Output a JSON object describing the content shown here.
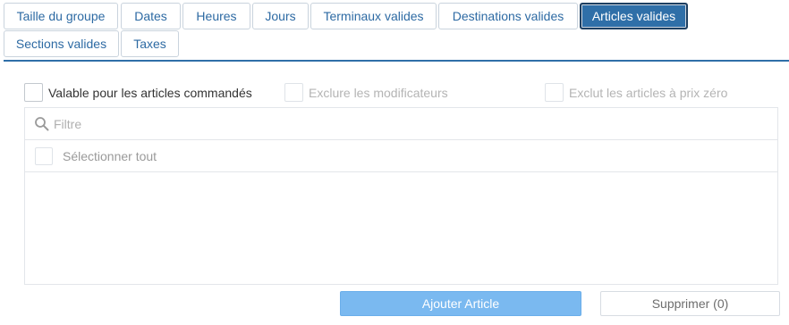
{
  "tabs": [
    {
      "label": "Taille du groupe",
      "active": false
    },
    {
      "label": "Dates",
      "active": false
    },
    {
      "label": "Heures",
      "active": false
    },
    {
      "label": "Jours",
      "active": false
    },
    {
      "label": "Terminaux valides",
      "active": false
    },
    {
      "label": "Destinations valides",
      "active": false
    },
    {
      "label": "Articles valides",
      "active": true
    },
    {
      "label": "Sections valides",
      "active": false
    },
    {
      "label": "Taxes",
      "active": false
    }
  ],
  "options": {
    "ordered_items": {
      "label": "Valable pour les articles commandés",
      "checked": false,
      "enabled": true
    },
    "exclude_modifiers": {
      "label": "Exclure les modificateurs",
      "checked": false,
      "enabled": false
    },
    "exclude_zero_price": {
      "label": "Exclut les articles à prix zéro",
      "checked": false,
      "enabled": false
    }
  },
  "list": {
    "filter_placeholder": "Filtre",
    "filter_value": "",
    "select_all_label": "Sélectionner tout",
    "items": []
  },
  "actions": {
    "add_label": "Ajouter Article",
    "delete_label": "Supprimer (0)"
  },
  "colors": {
    "accent": "#2f6fa8",
    "primary_button": "#7ab9f0",
    "tab_text": "#2d6aa3"
  }
}
